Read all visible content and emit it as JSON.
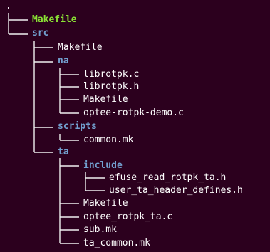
{
  "terminal": {
    "colors": {
      "background": "#2c001e",
      "directory": "#729fcf",
      "executable": "#8ae234",
      "file": "#ffffff",
      "tree_lines": "#f0f0f0"
    },
    "tree": {
      "root": ".",
      "entries": [
        {
          "name": "Makefile",
          "kind": "executable"
        },
        {
          "name": "src",
          "kind": "directory"
        },
        {
          "name": "Makefile",
          "kind": "file"
        },
        {
          "name": "na",
          "kind": "directory"
        },
        {
          "name": "librotpk.c",
          "kind": "file"
        },
        {
          "name": "librotpk.h",
          "kind": "file"
        },
        {
          "name": "Makefile",
          "kind": "file"
        },
        {
          "name": "optee-rotpk-demo.c",
          "kind": "file"
        },
        {
          "name": "scripts",
          "kind": "directory"
        },
        {
          "name": "common.mk",
          "kind": "file"
        },
        {
          "name": "ta",
          "kind": "directory"
        },
        {
          "name": "include",
          "kind": "directory"
        },
        {
          "name": "efuse_read_rotpk_ta.h",
          "kind": "file"
        },
        {
          "name": "user_ta_header_defines.h",
          "kind": "file"
        },
        {
          "name": "Makefile",
          "kind": "file"
        },
        {
          "name": "optee_rotpk_ta.c",
          "kind": "file"
        },
        {
          "name": "sub.mk",
          "kind": "file"
        },
        {
          "name": "ta_common.mk",
          "kind": "file"
        }
      ]
    }
  }
}
